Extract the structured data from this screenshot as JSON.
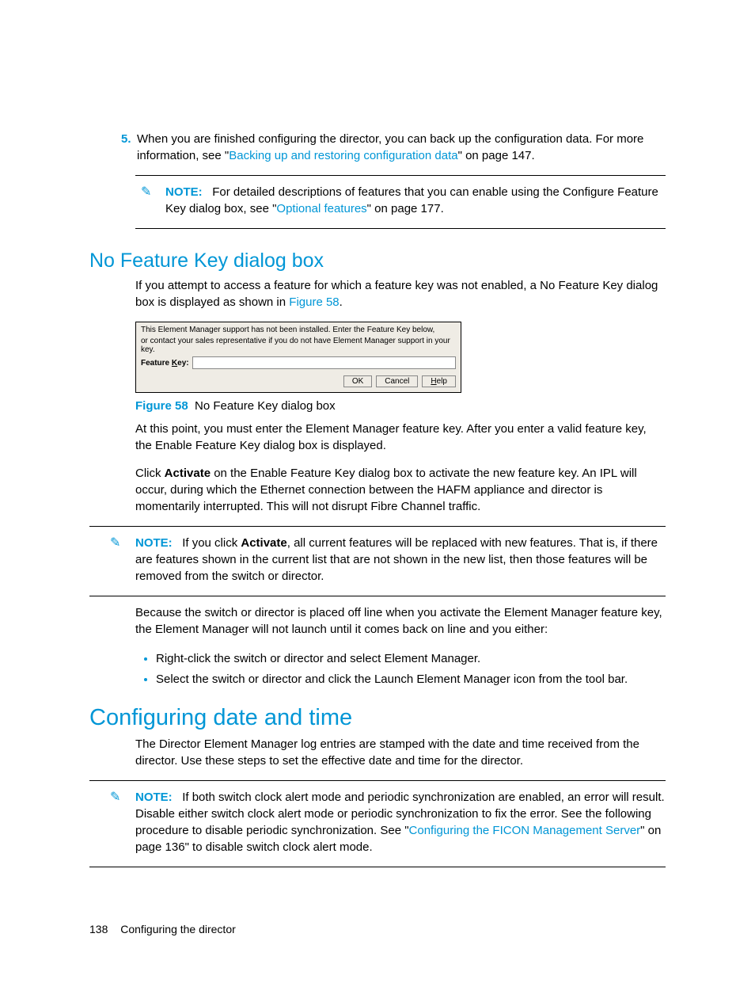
{
  "step5": {
    "num": "5.",
    "text_a": "When you are finished configuring the director, you can back up the configuration data. For more information, see \"",
    "link": "Backing up and restoring configuration data",
    "text_b": "\" on page 147."
  },
  "note1": {
    "label": "NOTE:",
    "text_a": "For detailed descriptions of features that you can enable using the Configure Feature Key dialog box, see \"",
    "link": "Optional features",
    "text_b": "\" on page 177."
  },
  "heading1": "No Feature Key dialog box",
  "para1": {
    "text_a": "If you attempt to access a feature for which a feature key was not enabled, a No Feature Key dialog box is displayed as shown in ",
    "link": "Figure 58",
    "text_b": "."
  },
  "dialog": {
    "line1": "This Element Manager support has not been installed. Enter the Feature Key below,",
    "line2": "or contact your sales representative if you do not have Element Manager support in your key.",
    "label": "Feature Key:",
    "ok": "OK",
    "cancel": "Cancel",
    "help": "Help"
  },
  "fig": {
    "label": "Figure 58",
    "caption": "No Feature Key dialog box"
  },
  "para2": "At this point, you must enter the Element Manager feature key. After you enter a valid feature key, the Enable Feature Key dialog box is displayed.",
  "para3": {
    "a": "Click ",
    "b": "Activate",
    "c": " on the Enable Feature Key dialog box to activate the new feature key. An IPL will occur, during which the Ethernet connection between the HAFM appliance and director is momentarily interrupted. This will not disrupt Fibre Channel traffic."
  },
  "note2": {
    "label": "NOTE:",
    "a": "If you click ",
    "b": "Activate",
    "c": ", all current features will be replaced with new features. That is, if there are features shown in the current list that are not shown in the new list, then those features will be removed from the switch or director."
  },
  "para4": "Because the switch or director is placed off line when you activate the Element Manager feature key, the Element Manager will not launch until it comes back on line and you either:",
  "list1": {
    "i1": "Right-click the switch or director and select Element Manager.",
    "i2": "Select the switch or director and click the Launch Element Manager icon from the tool bar."
  },
  "heading2": "Configuring date and time",
  "para5": "The Director Element Manager log entries are stamped with the date and time received from the director. Use these steps to set the effective date and time for the director.",
  "note3": {
    "label": "NOTE:",
    "a": "If both switch clock alert mode and periodic synchronization are enabled, an error will result. Disable either switch clock alert mode or periodic synchronization to fix the error. See the following procedure to disable periodic synchronization. See \"",
    "link": "Configuring the FICON Management Server",
    "b": "\" on page 136\" to disable switch clock alert mode."
  },
  "footer": {
    "page": "138",
    "title": "Configuring the director"
  }
}
